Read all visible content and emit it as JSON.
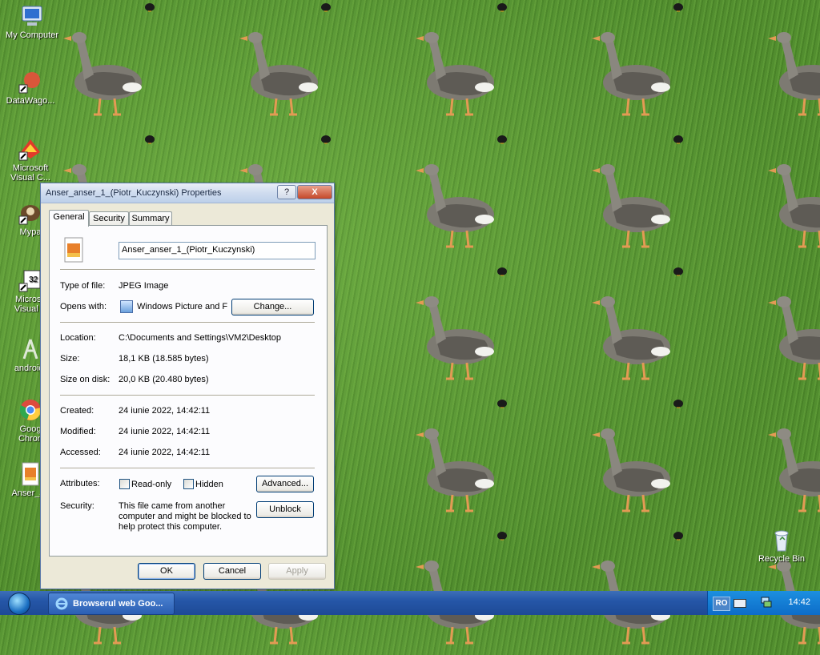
{
  "desktop": {
    "icons": [
      {
        "label_line1": "My Computer",
        "label_line2": ""
      },
      {
        "label_line1": "DataWago...",
        "label_line2": ""
      },
      {
        "label_line1": "Microsoft",
        "label_line2": "Visual C..."
      },
      {
        "label_line1": "Mypa",
        "label_line2": ""
      },
      {
        "label_line1": "Microsc",
        "label_line2": "Visual B"
      },
      {
        "label_line1": "android-",
        "label_line2": ""
      },
      {
        "label_line1": "Goog",
        "label_line2": "Chron"
      },
      {
        "label_line1": "Anser_an",
        "label_line2": ""
      },
      {
        "label_line1": "Recycle Bin",
        "label_line2": ""
      }
    ]
  },
  "dialog": {
    "title": "Anser_anser_1_(Piotr_Kuczynski) Properties",
    "help_label": "?",
    "close_label": "X",
    "tabs": [
      "General",
      "Security",
      "Summary"
    ],
    "filename": "Anser_anser_1_(Piotr_Kuczynski)",
    "type_label": "Type of file:",
    "type_value": "JPEG Image",
    "opens_label": "Opens with:",
    "opens_value": "Windows Picture and F",
    "change_button": "Change...",
    "location_label": "Location:",
    "location_value": "C:\\Documents and Settings\\VM2\\Desktop",
    "size_label": "Size:",
    "size_value": "18,1 KB (18.585 bytes)",
    "sizeondisk_label": "Size on disk:",
    "sizeondisk_value": "20,0 KB (20.480 bytes)",
    "created_label": "Created:",
    "created_value": "24 iunie 2022, 14:42:11",
    "modified_label": "Modified:",
    "modified_value": "24 iunie 2022, 14:42:11",
    "accessed_label": "Accessed:",
    "accessed_value": "24 iunie 2022, 14:42:11",
    "attributes_label": "Attributes:",
    "readonly_label": "Read-only",
    "hidden_label": "Hidden",
    "advanced_button": "Advanced...",
    "security_label": "Security:",
    "security_text_1": "This file came from another",
    "security_text_2": "computer and might be blocked to",
    "security_text_3": "help protect this computer.",
    "unblock_button": "Unblock",
    "ok_button": "OK",
    "cancel_button": "Cancel",
    "apply_button": "Apply"
  },
  "taskbar": {
    "item_label": "Browserul web Goo...",
    "language": "RO",
    "clock": "14:42"
  }
}
